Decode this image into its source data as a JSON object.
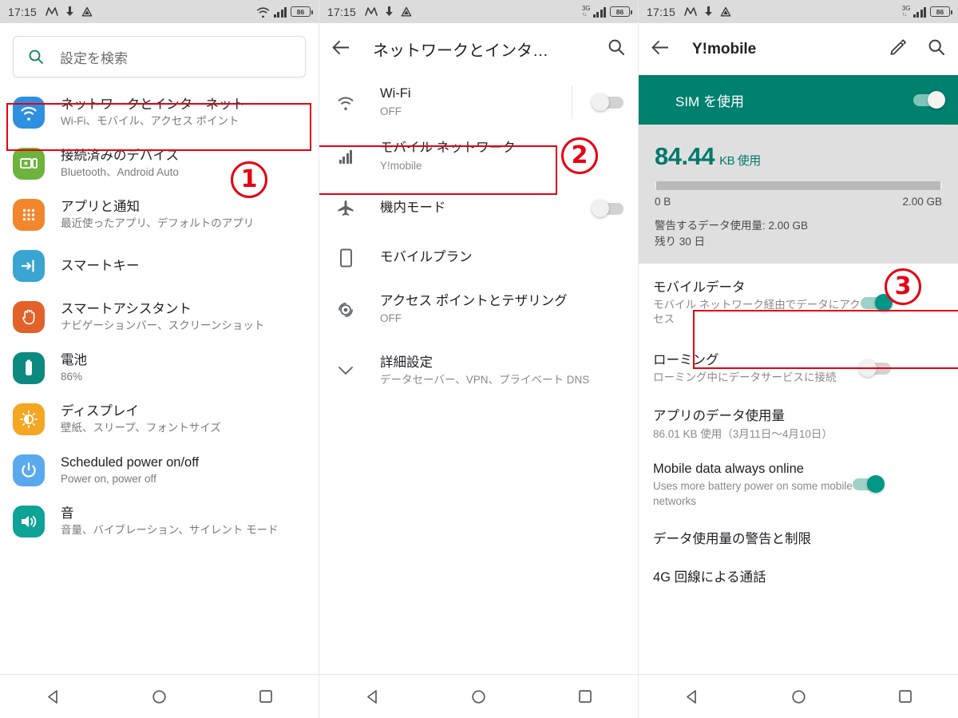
{
  "statusbar": {
    "time": "17:15",
    "battery": "86",
    "network_label": "3G",
    "icons": [
      "messenger-icon",
      "download-icon",
      "drive-icon"
    ]
  },
  "screen1": {
    "search": {
      "placeholder": "設定を検索",
      "icon": "search-icon"
    },
    "items": [
      {
        "title": "ネットワークとインターネット",
        "sub": "Wi-Fi、モバイル、アクセス ポイント",
        "icon": "wifi-icon",
        "color": "#2f8fe0"
      },
      {
        "title": "接続済みのデバイス",
        "sub": "Bluetooth、Android Auto",
        "icon": "devices-icon",
        "color": "#6cb43c"
      },
      {
        "title": "アプリと通知",
        "sub": "最近使ったアプリ、デフォルトのアプリ",
        "icon": "apps-grid-icon",
        "color": "#f2862c"
      },
      {
        "title": "スマートキー",
        "sub": "",
        "icon": "smart-key-icon",
        "color": "#3aa5d1"
      },
      {
        "title": "スマートアシスタント",
        "sub": "ナビゲーションバー、スクリーンショット",
        "icon": "hand-icon",
        "color": "#e2622a"
      },
      {
        "title": "電池",
        "sub": "86%",
        "icon": "battery-icon",
        "color": "#0d8a80"
      },
      {
        "title": "ディスプレイ",
        "sub": "壁紙、スリープ、フォントサイズ",
        "icon": "brightness-icon",
        "color": "#f5a623"
      },
      {
        "title": "Scheduled power on/off",
        "sub": "Power on, power off",
        "icon": "power-icon",
        "color": "#5aa9ef"
      },
      {
        "title": "音",
        "sub": "音量、バイブレーション、サイレント モード",
        "icon": "volume-icon",
        "color": "#0fa297"
      }
    ],
    "annotation": {
      "number": "①",
      "digit": "1"
    }
  },
  "screen2": {
    "toolbar": {
      "title": "ネットワークとインタ…",
      "back": "back-arrow-icon",
      "search": "search-icon"
    },
    "items": [
      {
        "title": "Wi-Fi",
        "sub": "OFF",
        "icon": "wifi-icon",
        "toggle": "off"
      },
      {
        "title": "モバイル ネットワーク",
        "sub": "Y!mobile",
        "icon": "signal-bars-icon",
        "toggle": null
      },
      {
        "title": "機内モード",
        "sub": "",
        "icon": "airplane-icon",
        "toggle": "off"
      },
      {
        "title": "モバイルプラン",
        "sub": "",
        "icon": "sim-card-icon",
        "toggle": null
      },
      {
        "title": "アクセス ポイントとテザリング",
        "sub": "OFF",
        "icon": "hotspot-icon",
        "toggle": null
      },
      {
        "title": "詳細設定",
        "sub": "データセーバー、VPN、プライベート DNS",
        "icon": "chevron-down-icon",
        "toggle": null
      }
    ],
    "annotation": {
      "digit": "2"
    }
  },
  "screen3": {
    "toolbar": {
      "title": "Y!mobile",
      "back": "back-arrow-icon",
      "edit": "pencil-icon",
      "search": "search-icon"
    },
    "sim": {
      "label": "SIM を使用",
      "toggle": "on"
    },
    "usage": {
      "amount": "84.44",
      "unit": "KB 使用",
      "min_label": "0 B",
      "max_label": "2.00 GB",
      "warning": "警告するデータ使用量: 2.00 GB",
      "remaining": "残り 30 日",
      "progress_percent": 0.2
    },
    "items": [
      {
        "title": "モバイルデータ",
        "sub": "モバイル ネットワーク経由でデータにアクセス",
        "toggle": "on"
      },
      {
        "title": "ローミング",
        "sub": "ローミング中にデータサービスに接続",
        "toggle": "off"
      },
      {
        "title": "アプリのデータ使用量",
        "sub": "86.01 KB 使用（3月11日〜4月10日）",
        "toggle": null
      },
      {
        "title": "Mobile data always online",
        "sub": "Uses more battery power on some mobile networks",
        "toggle": "on"
      },
      {
        "title": "データ使用量の警告と制限",
        "sub": "",
        "toggle": null
      },
      {
        "title": "4G 回線による通話",
        "sub": "",
        "toggle": null
      }
    ],
    "annotation": {
      "digit": "3"
    }
  },
  "navbar": {
    "back": "nav-back-icon",
    "home": "nav-home-icon",
    "recents": "nav-recents-icon"
  },
  "colors": {
    "accent_teal": "#00796b",
    "sim_bar": "#00806f",
    "annotation_red": "#e60012"
  }
}
